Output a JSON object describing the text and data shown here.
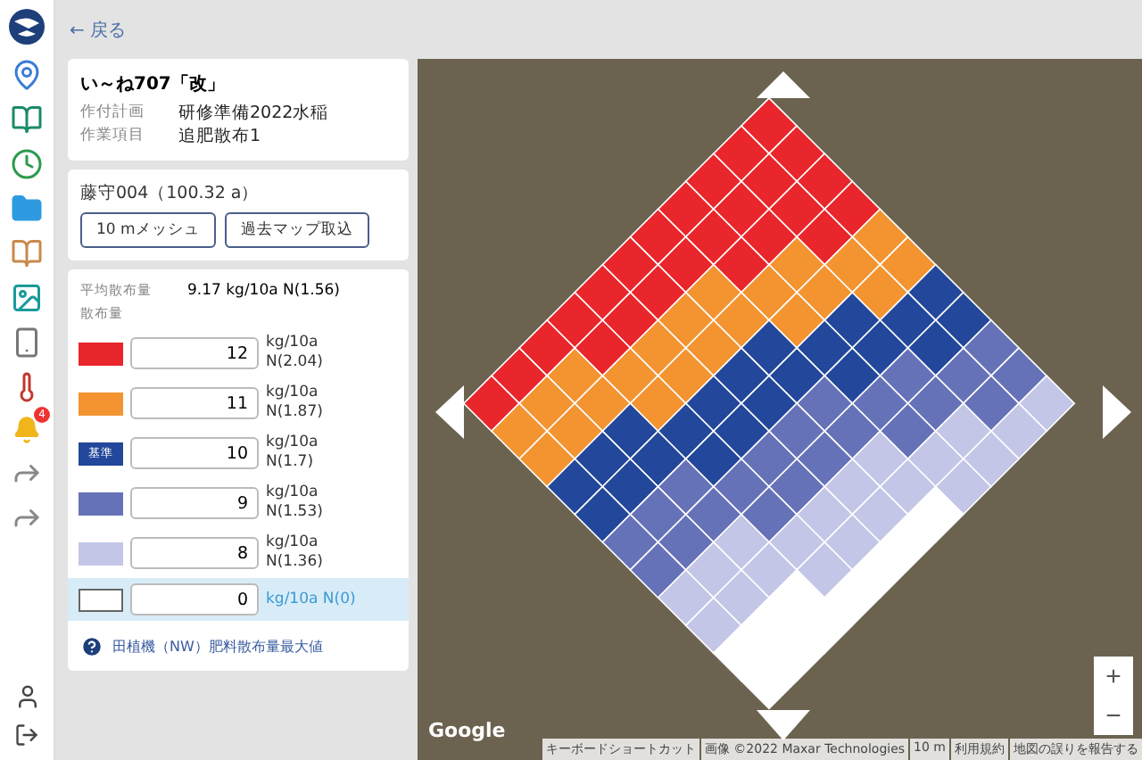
{
  "back_link": "← 戻る",
  "job": {
    "title": "い～ね707「改」",
    "fields": [
      {
        "label": "作付計画",
        "value": "研修準備2022水稲"
      },
      {
        "label": "作業項目",
        "value": "追肥散布1"
      }
    ]
  },
  "field": {
    "name": "藤守004（100.32 a）",
    "buttons": [
      "10 mメッシュ",
      "過去マップ取込"
    ]
  },
  "rates": {
    "average_label": "平均散布量",
    "average_value": "9.17 kg/10a N(1.56)",
    "section_label": "散布量",
    "rows": [
      {
        "kind": "swatch",
        "color": "#e8262b",
        "value": "12",
        "unit": "kg/10a N(2.04)",
        "selected": false
      },
      {
        "kind": "swatch",
        "color": "#f39431",
        "value": "11",
        "unit": "kg/10a N(1.87)",
        "selected": false
      },
      {
        "kind": "labeled",
        "color": "#23479a",
        "swatch_text": "基準",
        "value": "10",
        "unit": "kg/10a N(1.7)",
        "selected": false
      },
      {
        "kind": "swatch",
        "color": "#6672b8",
        "value": "9",
        "unit": "kg/10a N(1.53)",
        "selected": false
      },
      {
        "kind": "swatch",
        "color": "#c3c6e6",
        "value": "8",
        "unit": "kg/10a N(1.36)",
        "selected": false
      },
      {
        "kind": "swatch",
        "color": "#ffffff",
        "value": "0",
        "unit": "kg/10a N(0)",
        "selected": true
      }
    ],
    "help": "田植機（NW）肥料散布量最大値"
  },
  "notification_count": "4",
  "map": {
    "logo": "Google",
    "attribution": [
      "キーボードショートカット",
      "画像 ©2022 Maxar Technologies",
      "10 m",
      "利用規約",
      "地図の誤りを報告する"
    ],
    "zoom_in": "+",
    "zoom_out": "−"
  }
}
